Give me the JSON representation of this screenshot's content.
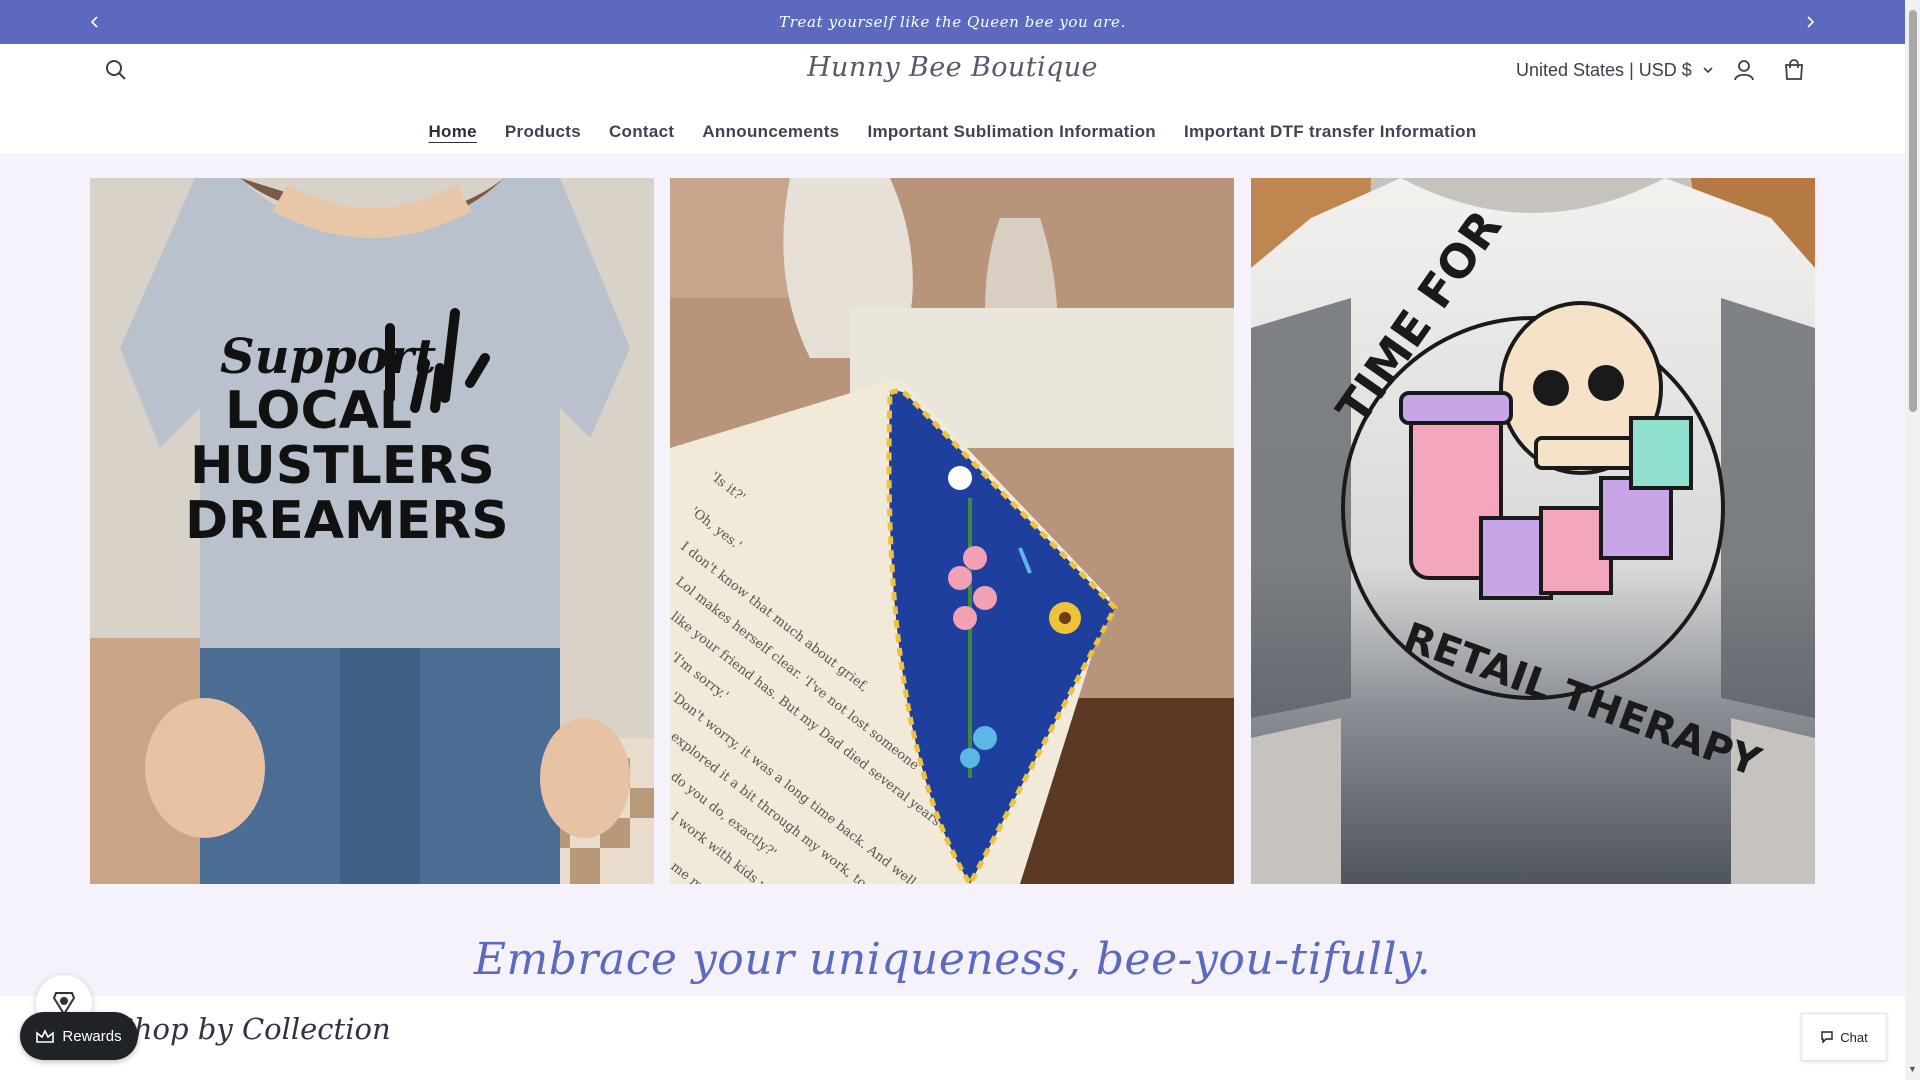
{
  "announcement": {
    "text": "Treat yourself like the Queen bee you are.",
    "prev_icon": "chevron-left-icon",
    "next_icon": "chevron-right-icon"
  },
  "header": {
    "store_name": "Hunny Bee Boutique",
    "currency": "United States | USD $",
    "icons": [
      "search-icon",
      "chevron-down-icon",
      "account-icon",
      "cart-icon"
    ]
  },
  "nav": {
    "items": [
      {
        "label": "Home",
        "active": true
      },
      {
        "label": "Products"
      },
      {
        "label": "Contact"
      },
      {
        "label": "Announcements"
      },
      {
        "label": "Important Sublimation Information"
      },
      {
        "label": "Important DTF transfer Information"
      }
    ]
  },
  "hero": {
    "tile1": {
      "line1": "Support",
      "line2": "LOCAL",
      "line3": "HUSTLERS",
      "line4": "DREAMERS"
    },
    "tile3": {
      "top": "TIME FOR",
      "bottom": "RETAIL THERAPY"
    }
  },
  "tagline": "Embrace your uniqueness, bee-you-tifully.",
  "collection": {
    "title": "Shop by Collection"
  },
  "widgets": {
    "rewards_label": "Rewards",
    "chat_label": "Chat"
  },
  "colors": {
    "announcement_bg": "#5b6abf",
    "accent": "#5b6abf",
    "page_bg": "#f5f2fb"
  }
}
